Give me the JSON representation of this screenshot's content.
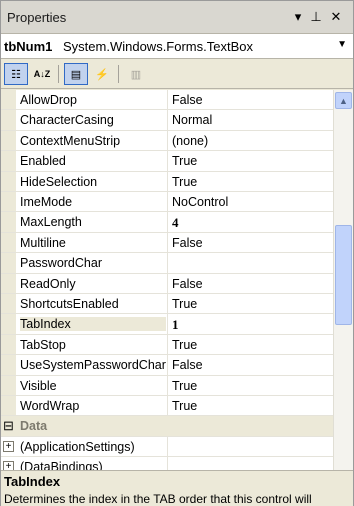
{
  "window": {
    "title": "Properties"
  },
  "titlebar": {
    "dropdown_glyph": "▾",
    "pin_glyph": "⊥",
    "close_glyph": "✕"
  },
  "object_selector": {
    "name": "tbNum1",
    "type": "System.Windows.Forms.TextBox",
    "dropdown_glyph": "▼"
  },
  "toolbar": {
    "categorized_glyph": "☷",
    "alphabetical_glyph": "A↓Z",
    "properties_glyph": "▤",
    "events_glyph": "⚡",
    "property_pages_glyph": "▥"
  },
  "properties": [
    {
      "name": "AllowDrop",
      "value": "False",
      "bold": false
    },
    {
      "name": "CharacterCasing",
      "value": "Normal",
      "bold": false
    },
    {
      "name": "ContextMenuStrip",
      "value": "(none)",
      "bold": false
    },
    {
      "name": "Enabled",
      "value": "True",
      "bold": false
    },
    {
      "name": "HideSelection",
      "value": "True",
      "bold": false
    },
    {
      "name": "ImeMode",
      "value": "NoControl",
      "bold": false
    },
    {
      "name": "MaxLength",
      "value": "4",
      "bold": true
    },
    {
      "name": "Multiline",
      "value": "False",
      "bold": false
    },
    {
      "name": "PasswordChar",
      "value": "",
      "bold": false
    },
    {
      "name": "ReadOnly",
      "value": "False",
      "bold": false
    },
    {
      "name": "ShortcutsEnabled",
      "value": "True",
      "bold": false
    },
    {
      "name": "TabIndex",
      "value": "1",
      "bold": true,
      "selected": true
    },
    {
      "name": "TabStop",
      "value": "True",
      "bold": false
    },
    {
      "name": "UseSystemPasswordChar",
      "value": "False",
      "bold": false
    },
    {
      "name": "Visible",
      "value": "True",
      "bold": false
    },
    {
      "name": "WordWrap",
      "value": "True",
      "bold": false
    }
  ],
  "category_data": {
    "label": "Data",
    "expander": "⊟"
  },
  "application_settings": {
    "label": "(ApplicationSettings)",
    "expander": "+"
  },
  "data_bindings": {
    "label": "(DataBindings)",
    "expander": "+"
  },
  "description": {
    "title": "TabIndex",
    "text": "Determines the index in the TAB order that this control will"
  }
}
